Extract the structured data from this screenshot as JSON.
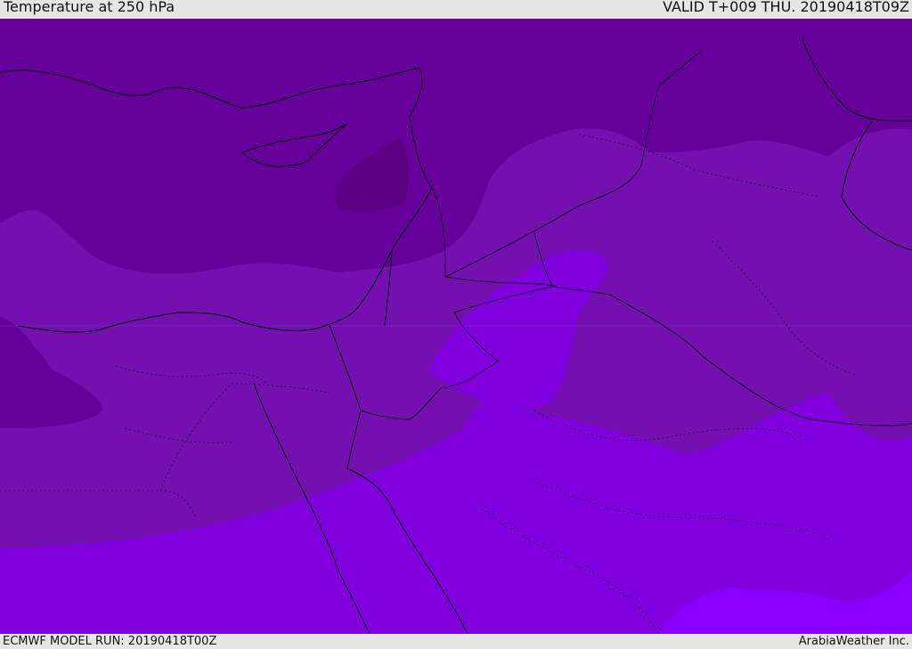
{
  "header": {
    "title": "Temperature at 250 hPa",
    "valid": "VALID T+009 THU. 20190418T09Z"
  },
  "footer": {
    "model_run": "ECMWF MODEL RUN: 20190418T00Z",
    "credit": "ArabiaWeather Inc."
  },
  "map": {
    "field_colors": {
      "coldest": "#5a0080",
      "colder": "#66009a",
      "mid": "#7410b0",
      "warm": "#7f00dc",
      "warmest": "#8a00ff"
    },
    "line_color": "#000000"
  }
}
